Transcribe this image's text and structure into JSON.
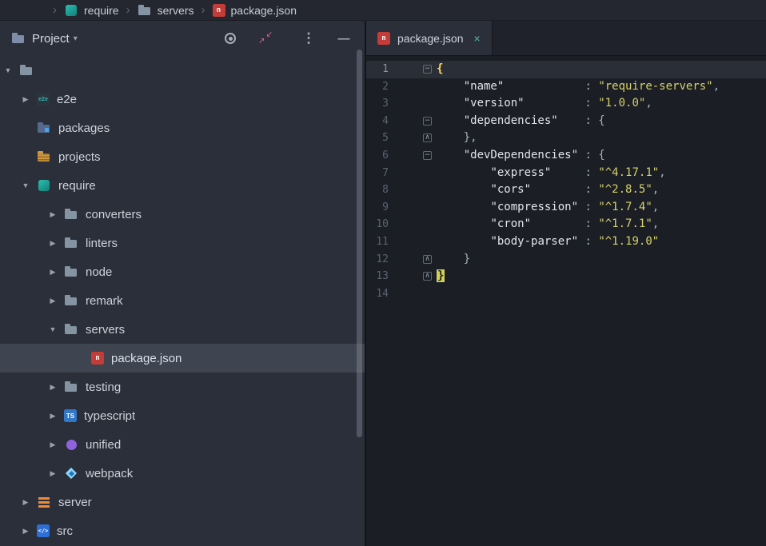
{
  "nav": {
    "separator": "›",
    "items": [
      {
        "label": "require",
        "icon": "require"
      },
      {
        "label": "servers",
        "icon": "folder"
      },
      {
        "label": "package.json",
        "icon": "npm"
      }
    ]
  },
  "sidebar": {
    "header": {
      "title": "Project",
      "chevron": "▾"
    },
    "toolbar": {
      "kebab": "⋮",
      "minimize": "—",
      "collapse_a": "↙",
      "collapse_b": "↗"
    },
    "tree": [
      {
        "label": "",
        "icon": "folder",
        "level": 0,
        "state": "expanded"
      },
      {
        "label": "e2e",
        "icon": "e2e",
        "level": 1,
        "state": "collapsed"
      },
      {
        "label": "packages",
        "icon": "folder-packages",
        "level": 1,
        "state": "none"
      },
      {
        "label": "projects",
        "icon": "folder-projects",
        "level": 1,
        "state": "none"
      },
      {
        "label": "require",
        "icon": "require",
        "level": 1,
        "state": "expanded"
      },
      {
        "label": "converters",
        "icon": "folder",
        "level": 2,
        "state": "collapsed"
      },
      {
        "label": "linters",
        "icon": "folder",
        "level": 2,
        "state": "collapsed"
      },
      {
        "label": "node",
        "icon": "folder",
        "level": 2,
        "state": "collapsed"
      },
      {
        "label": "remark",
        "icon": "folder",
        "level": 2,
        "state": "collapsed"
      },
      {
        "label": "servers",
        "icon": "folder",
        "level": 2,
        "state": "expanded"
      },
      {
        "label": "package.json",
        "icon": "npm",
        "level": 3,
        "state": "none",
        "selected": true
      },
      {
        "label": "testing",
        "icon": "folder",
        "level": 2,
        "state": "collapsed"
      },
      {
        "label": "typescript",
        "icon": "typescript",
        "level": 2,
        "state": "collapsed"
      },
      {
        "label": "unified",
        "icon": "unified",
        "level": 2,
        "state": "collapsed"
      },
      {
        "label": "webpack",
        "icon": "webpack",
        "level": 2,
        "state": "collapsed"
      },
      {
        "label": "server",
        "icon": "server",
        "level": 1,
        "state": "collapsed"
      },
      {
        "label": "src",
        "icon": "src",
        "level": 1,
        "state": "collapsed"
      }
    ]
  },
  "editor": {
    "tab": {
      "label": "package.json",
      "close": "×"
    },
    "lines": [
      {
        "num": 1,
        "current": true,
        "fold": "start",
        "tokens": [
          {
            "t": "b1",
            "s": "{"
          }
        ]
      },
      {
        "num": 2,
        "tokens": [
          {
            "t": "p",
            "s": "    "
          },
          {
            "t": "k",
            "s": "\"name\""
          },
          {
            "t": "p",
            "s": "            : "
          },
          {
            "t": "s",
            "s": "\"require-servers\""
          },
          {
            "t": "p",
            "s": ","
          }
        ]
      },
      {
        "num": 3,
        "tokens": [
          {
            "t": "p",
            "s": "    "
          },
          {
            "t": "k",
            "s": "\"version\""
          },
          {
            "t": "p",
            "s": "         : "
          },
          {
            "t": "s",
            "s": "\"1.0.0\""
          },
          {
            "t": "p",
            "s": ","
          }
        ]
      },
      {
        "num": 4,
        "fold": "start",
        "tokens": [
          {
            "t": "p",
            "s": "    "
          },
          {
            "t": "k",
            "s": "\"dependencies\""
          },
          {
            "t": "p",
            "s": "    : {"
          }
        ]
      },
      {
        "num": 5,
        "fold": "end",
        "tokens": [
          {
            "t": "p",
            "s": "    },"
          }
        ]
      },
      {
        "num": 6,
        "fold": "start",
        "tokens": [
          {
            "t": "p",
            "s": "    "
          },
          {
            "t": "k",
            "s": "\"devDependencies\""
          },
          {
            "t": "p",
            "s": " : {"
          }
        ]
      },
      {
        "num": 7,
        "tokens": [
          {
            "t": "p",
            "s": "        "
          },
          {
            "t": "k",
            "s": "\"express\""
          },
          {
            "t": "p",
            "s": "     : "
          },
          {
            "t": "s",
            "s": "\"^4.17.1\""
          },
          {
            "t": "p",
            "s": ","
          }
        ]
      },
      {
        "num": 8,
        "tokens": [
          {
            "t": "p",
            "s": "        "
          },
          {
            "t": "k",
            "s": "\"cors\""
          },
          {
            "t": "p",
            "s": "        : "
          },
          {
            "t": "s",
            "s": "\"^2.8.5\""
          },
          {
            "t": "p",
            "s": ","
          }
        ]
      },
      {
        "num": 9,
        "tokens": [
          {
            "t": "p",
            "s": "        "
          },
          {
            "t": "k",
            "s": "\"compression\""
          },
          {
            "t": "p",
            "s": " : "
          },
          {
            "t": "s",
            "s": "\"^1.7.4\""
          },
          {
            "t": "p",
            "s": ","
          }
        ]
      },
      {
        "num": 10,
        "tokens": [
          {
            "t": "p",
            "s": "        "
          },
          {
            "t": "k",
            "s": "\"cron\""
          },
          {
            "t": "p",
            "s": "        : "
          },
          {
            "t": "s",
            "s": "\"^1.7.1\""
          },
          {
            "t": "p",
            "s": ","
          }
        ]
      },
      {
        "num": 11,
        "tokens": [
          {
            "t": "p",
            "s": "        "
          },
          {
            "t": "k",
            "s": "\"body-parser\""
          },
          {
            "t": "p",
            "s": " : "
          },
          {
            "t": "s",
            "s": "\"^1.19.0\""
          }
        ]
      },
      {
        "num": 12,
        "fold": "end",
        "tokens": [
          {
            "t": "p",
            "s": "    }"
          }
        ]
      },
      {
        "num": 13,
        "fold": "end",
        "tokens": [
          {
            "t": "b2",
            "s": "}"
          }
        ]
      },
      {
        "num": 14,
        "tokens": []
      }
    ]
  },
  "glyphs": {
    "expanded": "▼",
    "collapsed": "▶",
    "fold_start": "−",
    "fold_end": "∧"
  },
  "icon_glyphs": {
    "npm": "n",
    "typescript": "TS",
    "src": "</>",
    "e2e": "e2e"
  },
  "colors": {
    "accent_teal": "#2bbbad",
    "npm_red": "#c43c38",
    "string_yellow": "#d6d26a",
    "selection_bg": "#3e4450",
    "current_line_bg": "#2a2e37"
  }
}
